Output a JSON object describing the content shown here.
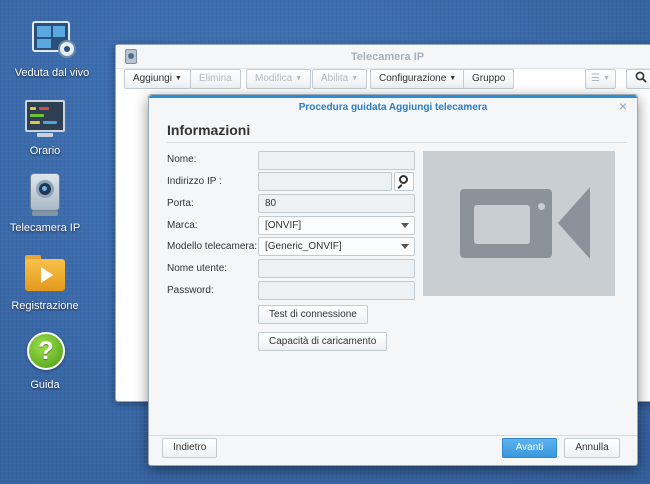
{
  "desktop": {
    "icons": [
      {
        "label": "Veduta dal vivo",
        "icon": "live-view-icon"
      },
      {
        "label": "Orario",
        "icon": "timeline-icon"
      },
      {
        "label": "Telecamera IP",
        "icon": "ip-camera-icon"
      },
      {
        "label": "Registrazione",
        "icon": "recording-folder-icon"
      },
      {
        "label": "Guida",
        "icon": "help-icon",
        "glyph": "?"
      }
    ]
  },
  "app_window": {
    "title": "Telecamera IP",
    "toolbar": {
      "add": "Aggiungi",
      "delete": "Elimina",
      "edit": "Modifica",
      "enable": "Abilita",
      "configuration": "Configurazione",
      "group": "Gruppo",
      "view_toggle": "☰"
    }
  },
  "wizard": {
    "title": "Procedura guidata Aggiungi telecamera",
    "close": "×",
    "heading": "Informazioni",
    "fields": {
      "name": {
        "label": "Nome:",
        "value": ""
      },
      "ip": {
        "label": "Indirizzo IP :",
        "value": ""
      },
      "port": {
        "label": "Porta:",
        "value": "80"
      },
      "brand": {
        "label": "Marca:",
        "value": "[ONVIF]"
      },
      "model": {
        "label": "Modello telecamera:",
        "value": "[Generic_ONVIF]"
      },
      "username": {
        "label": "Nome utente:",
        "value": ""
      },
      "password": {
        "label": "Password:",
        "value": ""
      }
    },
    "buttons": {
      "test": "Test di connessione",
      "capability": "Capacità di caricamento"
    },
    "footer": {
      "back": "Indietro",
      "next": "Avanti",
      "cancel": "Annulla"
    }
  },
  "colors": {
    "desktop_bg": "#3b69a8",
    "accent": "#2d8bd6",
    "primary_button": "#3a98df"
  }
}
